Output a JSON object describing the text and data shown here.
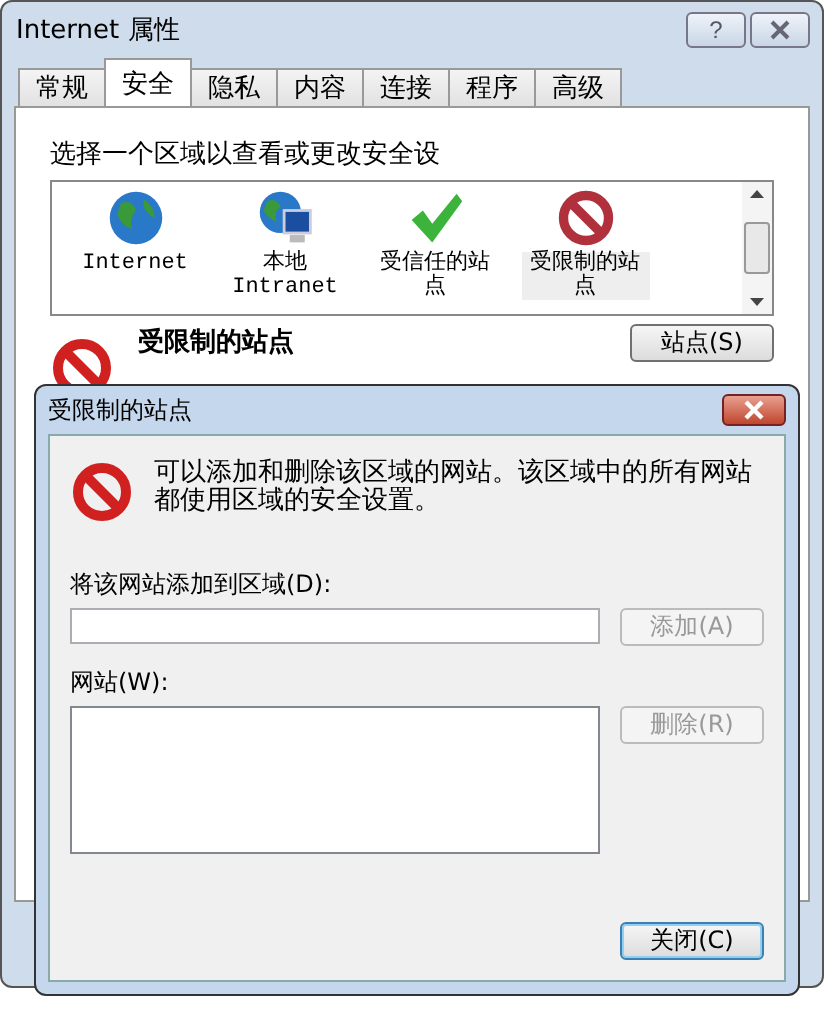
{
  "window": {
    "title": "Internet 属性",
    "help_button": "?"
  },
  "tabs": [
    {
      "label": "常规",
      "selected": false
    },
    {
      "label": "安全",
      "selected": true
    },
    {
      "label": "隐私",
      "selected": false
    },
    {
      "label": "内容",
      "selected": false
    },
    {
      "label": "连接",
      "selected": false
    },
    {
      "label": "程序",
      "selected": false
    },
    {
      "label": "高级",
      "selected": false
    }
  ],
  "zones": {
    "prompt": "选择一个区域以查看或更改安全设",
    "items": [
      {
        "label": "Internet",
        "kind": "internet",
        "selected": false
      },
      {
        "label": "本地 Intranet",
        "kind": "intranet",
        "selected": false
      },
      {
        "label": "受信任的站点",
        "kind": "trusted",
        "selected": false
      },
      {
        "label": "受限制的站点",
        "kind": "restricted",
        "selected": true
      }
    ]
  },
  "zone_detail": {
    "title": "受限制的站点",
    "sites_button": "站点(S)"
  },
  "dialog": {
    "title": "受限制的站点",
    "message": "可以添加和删除该区域的网站。该区域中的所有网站都使用区域的安全设置。",
    "add_label": "将该网站添加到区域(D):",
    "add_button": {
      "label": "添加(A)",
      "disabled": true
    },
    "sites_label": "网站(W):",
    "remove_button": {
      "label": "删除(R)",
      "disabled": true
    },
    "close_button": "关闭(C)"
  }
}
